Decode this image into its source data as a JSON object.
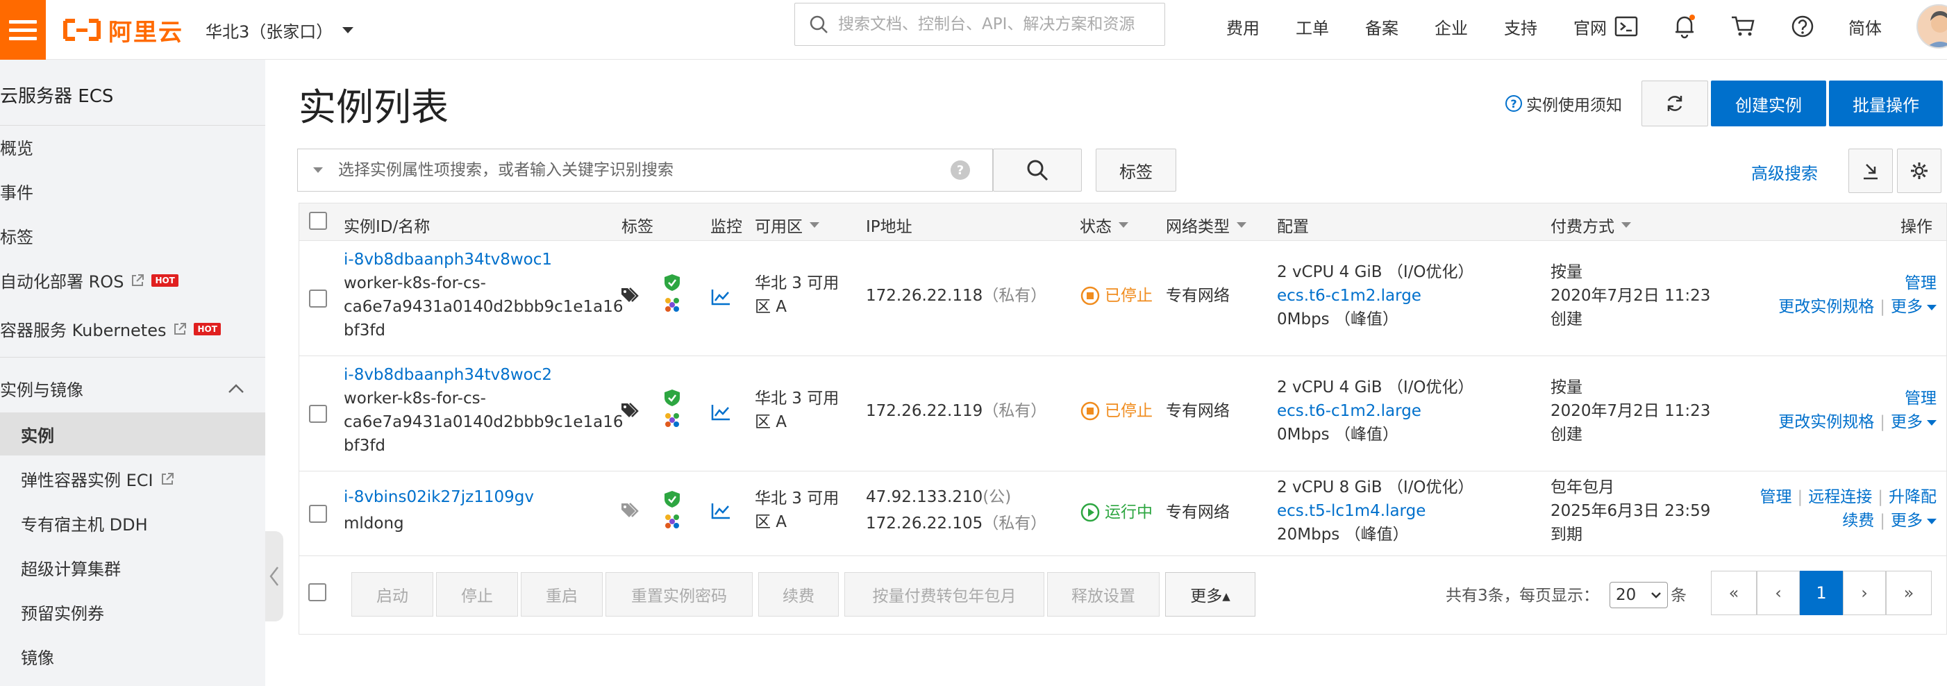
{
  "topbar": {
    "logo_text": "阿里云",
    "region": "华北3（张家口）",
    "search_placeholder": "搜索文档、控制台、API、解决方案和资源",
    "nav": [
      "费用",
      "工单",
      "备案",
      "企业",
      "支持",
      "官网"
    ],
    "lang": "简体",
    "brand_color": "#ff6a00"
  },
  "sidebar": {
    "title": "云服务器 ECS",
    "items": [
      {
        "label": "概览"
      },
      {
        "label": "事件"
      },
      {
        "label": "标签"
      },
      {
        "label": "自动化部署 ROS",
        "badge": "HOT"
      },
      {
        "label": "容器服务 Kubernetes",
        "badge": "HOT"
      }
    ],
    "group": "实例与镜像",
    "sub_items": [
      {
        "label": "实例",
        "active": true
      },
      {
        "label": "弹性容器实例 ECI"
      },
      {
        "label": "专有宿主机 DDH"
      },
      {
        "label": "超级计算集群"
      },
      {
        "label": "预留实例券"
      },
      {
        "label": "镜像"
      }
    ]
  },
  "main": {
    "title": "实例列表",
    "notice": "实例使用须知",
    "create_btn": "创建实例",
    "batch_btn": "批量操作",
    "filter_placeholder": "选择实例属性项搜索，或者输入关键字识别搜索",
    "tag_btn": "标签",
    "advanced_search": "高级搜索",
    "accent": "#0070cc"
  },
  "table": {
    "columns": [
      "实例ID/名称",
      "标签",
      "监控",
      "可用区",
      "IP地址",
      "状态",
      "网络类型",
      "配置",
      "付费方式",
      "操作"
    ],
    "rows": [
      {
        "id": "i-8vb8dbaanph34tv8woc1",
        "name_lines": [
          "worker-k8s-for-cs-",
          "ca6e7a9431a0140d2bbb9c1e1a16",
          "bf3fd"
        ],
        "zone_lines": [
          "华北 3 可用",
          "区 A"
        ],
        "ip": "172.26.22.118",
        "ip_note": "（私有）",
        "status": "已停止",
        "network": "专有网络",
        "config_spec": "2 vCPU 4 GiB （I/O优化）",
        "config_type": "ecs.t6-c1m2.large",
        "config_bw": "0Mbps （峰值）",
        "billing_lines": [
          "按量",
          "2020年7月2日 11:23",
          "创建"
        ],
        "op_manage": "管理",
        "op_change": "更改实例规格",
        "op_more": "更多"
      },
      {
        "id": "i-8vb8dbaanph34tv8woc2",
        "name_lines": [
          "worker-k8s-for-cs-",
          "ca6e7a9431a0140d2bbb9c1e1a16",
          "bf3fd"
        ],
        "zone_lines": [
          "华北 3 可用",
          "区 A"
        ],
        "ip": "172.26.22.119",
        "ip_note": "（私有）",
        "status": "已停止",
        "network": "专有网络",
        "config_spec": "2 vCPU 4 GiB （I/O优化）",
        "config_type": "ecs.t6-c1m2.large",
        "config_bw": "0Mbps （峰值）",
        "billing_lines": [
          "按量",
          "2020年7月2日 11:23",
          "创建"
        ],
        "op_manage": "管理",
        "op_change": "更改实例规格",
        "op_more": "更多"
      },
      {
        "id": "i-8vbins02ik27jz1109gv",
        "name_lines": [
          "mldong"
        ],
        "zone_lines": [
          "华北 3 可用",
          "区 A"
        ],
        "ip_public": "47.92.133.210",
        "ip_public_note": "(公)",
        "ip": "172.26.22.105",
        "ip_note": "（私有）",
        "status": "运行中",
        "network": "专有网络",
        "config_spec": "2 vCPU 8 GiB （I/O优化）",
        "config_type": "ecs.t5-lc1m4.large",
        "config_bw": "20Mbps （峰值）",
        "billing_lines": [
          "包年包月",
          "2025年6月3日 23:59",
          "到期"
        ],
        "op_manage": "管理",
        "op_remote": "远程连接",
        "op_upgrade": "升降配",
        "op_renew": "续费",
        "op_more": "更多"
      }
    ]
  },
  "footer": {
    "buttons": [
      "启动",
      "停止",
      "重启",
      "重置实例密码",
      "续费",
      "按量付费转包年包月",
      "释放设置"
    ],
    "more_btn": "更多▴",
    "total": "共有3条，",
    "per_page_label": "每页显示：",
    "per_page": "20",
    "per_page_unit": "条",
    "pager": [
      "«",
      "‹",
      "1",
      "›",
      "»"
    ]
  }
}
